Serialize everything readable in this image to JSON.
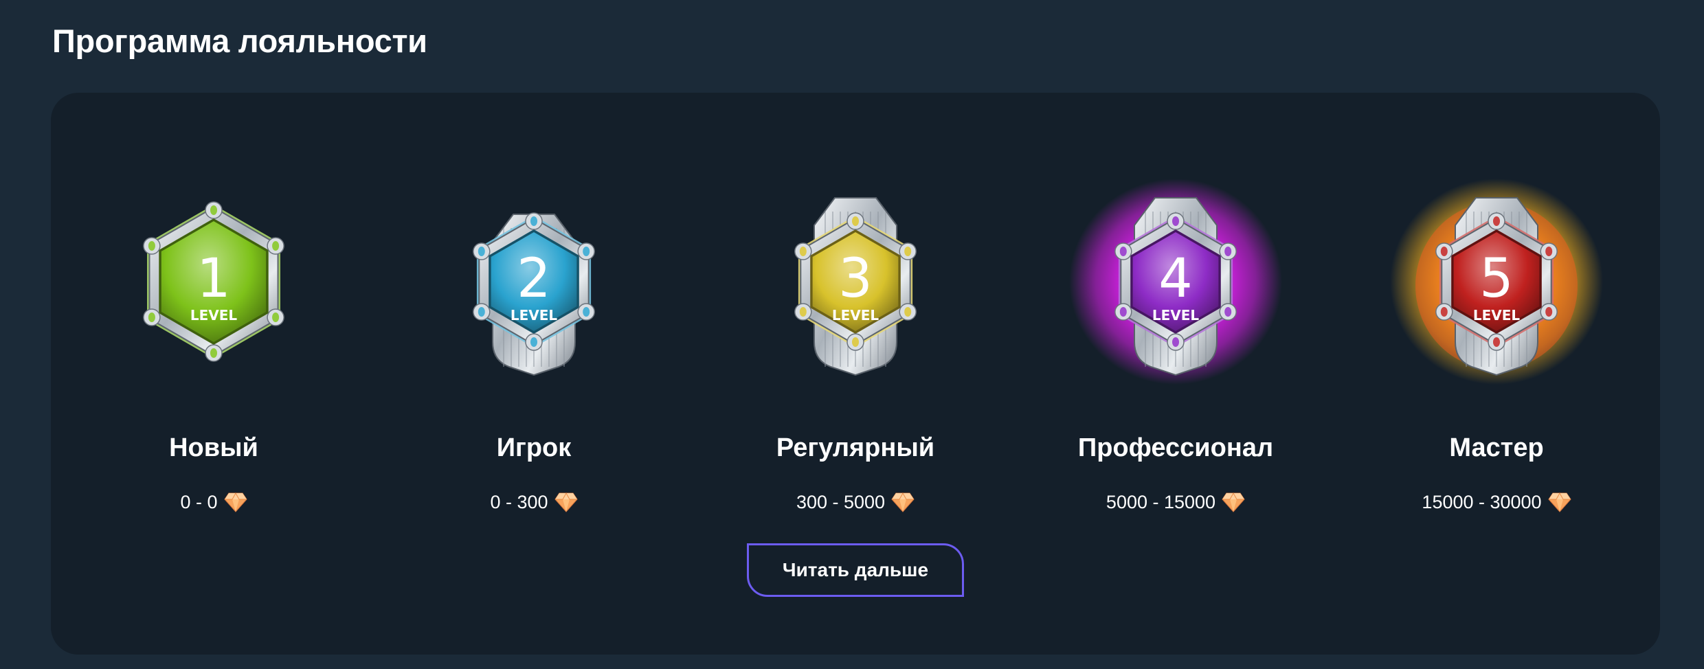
{
  "page": {
    "title": "Программа лояльности"
  },
  "levels": [
    {
      "number": "1",
      "badge_caption": "LEVEL",
      "name": "Новый",
      "range": "0 - 0",
      "color": "#7ec21a",
      "glow": "none"
    },
    {
      "number": "2",
      "badge_caption": "LEVEL",
      "name": "Игрок",
      "range": "0 - 300",
      "color": "#2aa3cf",
      "glow": "none"
    },
    {
      "number": "3",
      "badge_caption": "LEVEL",
      "name": "Регулярный",
      "range": "300 - 5000",
      "color": "#d8c22c",
      "glow": "none"
    },
    {
      "number": "4",
      "badge_caption": "LEVEL",
      "name": "Профессионал",
      "range": "5000 - 15000",
      "color": "#8e2cc6",
      "glow": "#e020f0"
    },
    {
      "number": "5",
      "badge_caption": "LEVEL",
      "name": "Мастер",
      "range": "15000 - 30000",
      "color": "#c0211f",
      "glow": "#ffb81c"
    }
  ],
  "currency_icon": "gem-icon",
  "read_more_label": "Читать дальше",
  "colors": {
    "page_background": "#1b2a38",
    "panel_background": "#141f2a",
    "button_border": "#6c5cf0",
    "gem": "#f7a35c"
  }
}
